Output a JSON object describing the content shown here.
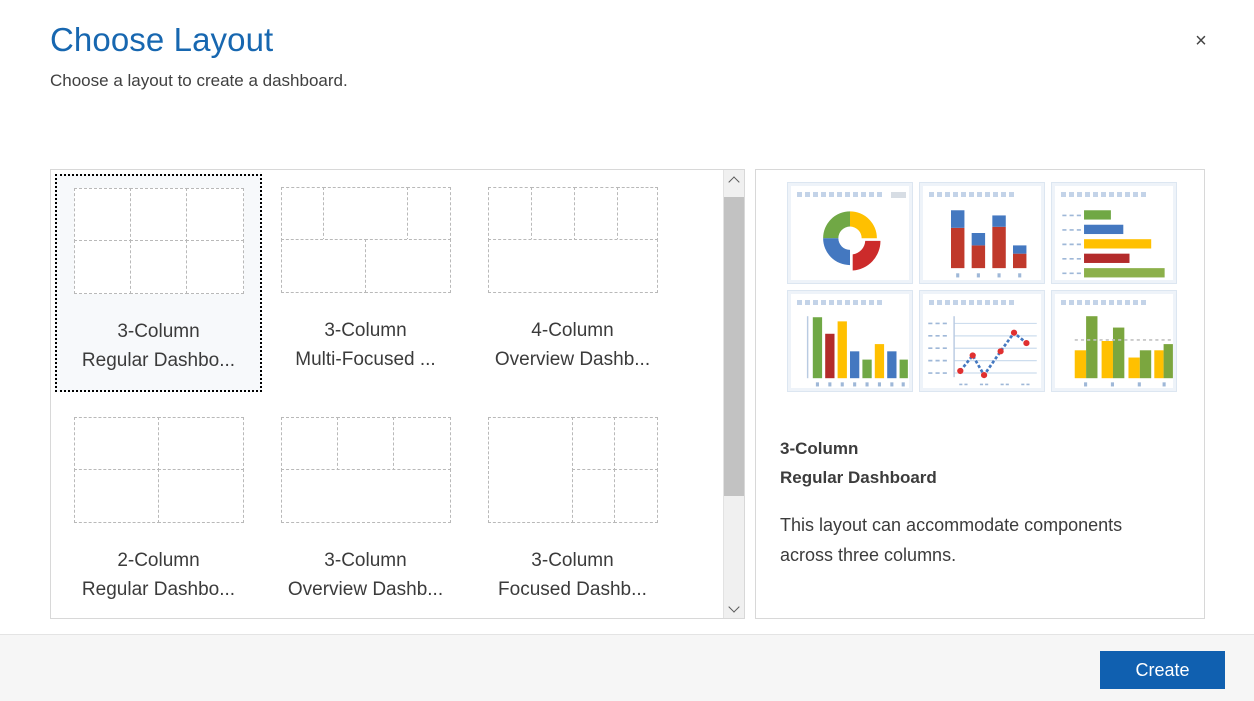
{
  "dialog": {
    "title": "Choose Layout",
    "subtitle": "Choose a layout to create a dashboard.",
    "close_label": "×"
  },
  "layouts": [
    {
      "name": "3-column-regular-dashboard",
      "line1": "3-Column",
      "line2": "Regular Dashbo...",
      "selected": true
    },
    {
      "name": "3-column-multi-focused",
      "line1": "3-Column",
      "line2": "Multi-Focused ...",
      "selected": false
    },
    {
      "name": "4-column-overview-dashboard",
      "line1": "4-Column",
      "line2": "Overview Dashb...",
      "selected": false
    },
    {
      "name": "2-column-regular-dashboard",
      "line1": "2-Column",
      "line2": "Regular Dashbo...",
      "selected": false
    },
    {
      "name": "3-column-overview-dashboard",
      "line1": "3-Column",
      "line2": "Overview Dashb...",
      "selected": false
    },
    {
      "name": "3-column-focused-dashboard",
      "line1": "3-Column",
      "line2": "Focused Dashb...",
      "selected": false
    }
  ],
  "scrollbar": {
    "up_icon": "chevron-up-icon",
    "down_icon": "chevron-down-icon"
  },
  "preview": {
    "desc_line1": "3-Column",
    "desc_line2": "Regular Dashboard",
    "description": "This layout can accommodate components across three columns."
  },
  "footer": {
    "create_label": "Create"
  },
  "colors": {
    "title_blue": "#1767b0",
    "button_blue": "#1060b0",
    "chart_green": "#70a845",
    "chart_blue": "#4478c0",
    "chart_yellow": "#ffc000",
    "chart_red": "#b32b2b",
    "chart_line": "#4478c0",
    "chart_marker": "#e03030"
  }
}
